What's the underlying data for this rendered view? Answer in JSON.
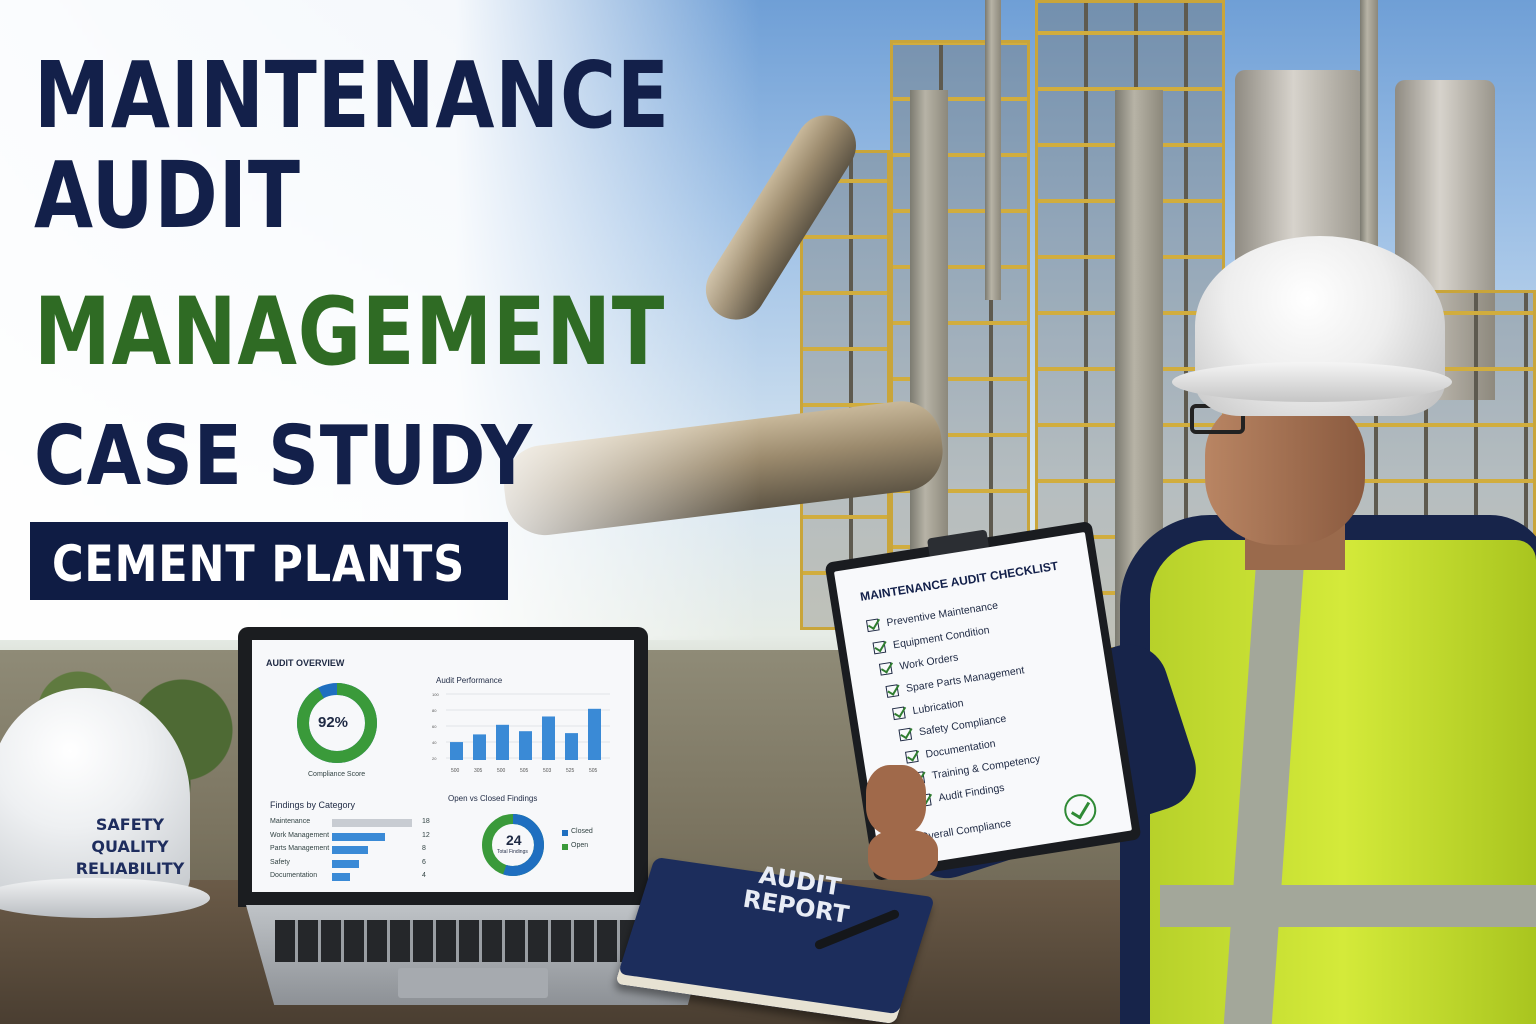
{
  "headline": {
    "line1": "MAINTENANCE",
    "line2": "AUDIT",
    "line3": "MANAGEMENT",
    "line4": "CASE STUDY",
    "banner": "CEMENT PLANTS"
  },
  "hard_hat": {
    "line1": "SAFETY",
    "line2": "QUALITY",
    "line3": "RELIABILITY"
  },
  "laptop": {
    "overview_title": "AUDIT OVERVIEW",
    "compliance_value": "92%",
    "compliance_label": "Compliance Score",
    "compliance_fraction": 0.92,
    "performance_title": "Audit Performance",
    "performance_bars": [
      0.28,
      0.4,
      0.55,
      0.45,
      0.68,
      0.42,
      0.8
    ],
    "performance_ticks": [
      "100",
      "80",
      "60",
      "40",
      "20"
    ],
    "performance_xlabels": [
      "500",
      "305",
      "500",
      "505",
      "503",
      "525",
      "505"
    ],
    "findings_title": "Findings by Category",
    "findings": [
      {
        "label": "Maintenance",
        "value": "18"
      },
      {
        "label": "Work Management",
        "value": "12"
      },
      {
        "label": "Parts Management",
        "value": "8"
      },
      {
        "label": "Safety",
        "value": "6"
      },
      {
        "label": "Documentation",
        "value": "4"
      }
    ],
    "open_closed_title": "Open vs Closed Findings",
    "total_value": "24",
    "total_label": "Total Findings",
    "legend_closed": "Closed",
    "legend_open": "Open"
  },
  "book": {
    "title_line1": "AUDIT",
    "title_line2": "REPORT"
  },
  "checklist": {
    "title": "MAINTENANCE AUDIT CHECKLIST",
    "items": [
      "Preventive Maintenance",
      "Equipment Condition",
      "Work Orders",
      "Spare Parts Management",
      "Lubrication",
      "Safety Compliance",
      "Documentation",
      "Training & Competency",
      "Audit Findings"
    ],
    "overall": "Overall Compliance"
  },
  "colors": {
    "navy": "#13204a",
    "green": "#2f6b24",
    "accent_blue": "#3a8ad6",
    "vest": "#c9e030"
  }
}
